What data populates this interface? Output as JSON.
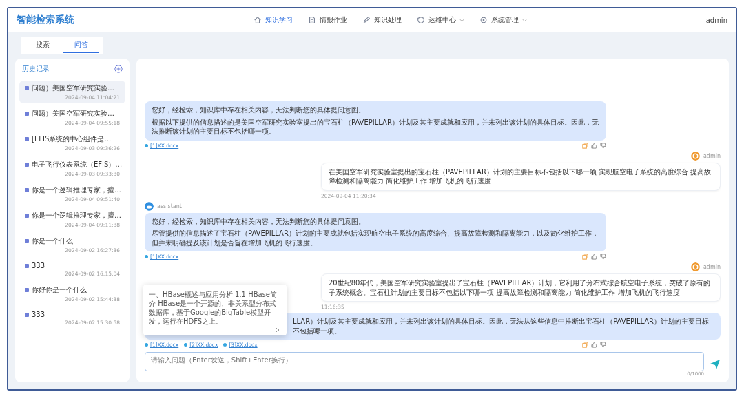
{
  "app": {
    "title": "智能检索系统",
    "user": "admin"
  },
  "nav": [
    {
      "label": "知识学习",
      "selected": true,
      "dropdown": false
    },
    {
      "label": "情报作业",
      "selected": false,
      "dropdown": false
    },
    {
      "label": "知识处理",
      "selected": false,
      "dropdown": false
    },
    {
      "label": "运维中心",
      "selected": false,
      "dropdown": true
    },
    {
      "label": "系统管理",
      "selected": false,
      "dropdown": true
    }
  ],
  "mode_tabs": [
    {
      "label": "搜索",
      "selected": false
    },
    {
      "label": "问答",
      "selected": true
    }
  ],
  "history": {
    "title": "历史记录",
    "items": [
      {
        "title": "问题）美国空军研究实验…",
        "time": "2024-09-04 11:04:21",
        "selected": true
      },
      {
        "title": "问题）美国空军研究实验…",
        "time": "2024-09-04 09:55:18",
        "selected": false
      },
      {
        "title": "[EFIS系统的中心组件是…",
        "time": "2024-09-03 09:36:26",
        "selected": false
      },
      {
        "title": "电子飞行仪表系统（EFIS）…",
        "time": "2024-09-03 09:33:30",
        "selected": false
      },
      {
        "title": "你是一个逻辑推理专家，擅…",
        "time": "2024-09-04 09:51:40",
        "selected": false
      },
      {
        "title": "你是一个逻辑推理专家，擅…",
        "time": "2024-09-04 09:11:38",
        "selected": false
      },
      {
        "title": "你是一个什么",
        "time": "2024-09-02 16:27:36",
        "selected": false
      },
      {
        "title": "333",
        "time": "2024-09-02 16:15:04",
        "selected": false
      },
      {
        "title": "你好你是一个什么",
        "time": "2024-09-02 15:44:38",
        "selected": false
      },
      {
        "title": "333",
        "time": "2024-09-02 15:30:58",
        "selected": false
      }
    ]
  },
  "messages": [
    {
      "kind": "answer",
      "paragraphs": [
        "您好，经检索，知识库中存在相关内容，无法判断您的具体提问意图。",
        "根据以下提供的信息描述的是美国空军研究实验室提出的宝石柱（PAVEPILLAR）计划及其主要成就和应用，并未列出该计划的具体目标。因此，无法推断该计划的主要目标不包括哪一项。"
      ],
      "sources": [
        "[1]XX.docx"
      ]
    },
    {
      "kind": "question",
      "name": "admin",
      "text": "在美国空军研究实验室提出的宝石柱（PAVEPILLAR）计划的主要目标不包括以下哪一项 实现航空电子系统的高度综合 提高故障检测和隔离能力 简化维护工作 增加飞机的飞行速度",
      "time": "2024-09-04 11:20:34"
    },
    {
      "kind": "answer",
      "name": "assistant",
      "paragraphs": [
        "您好，经检索，知识库中存在相关内容，无法判断您的具体提问意图。",
        "尽管提供的信息描述了宝石柱（PAVEPILLAR）计划的主要成就包括实现航空电子系统的高度综合、提高故障检测和隔离能力，以及简化维护工作，但并未明确提及该计划是否旨在增加飞机的飞行速度。"
      ],
      "sources": [
        "[1]XX.docx"
      ]
    },
    {
      "kind": "question",
      "name": "admin",
      "text": "20世纪80年代，美国空军研究实验室提出了宝石柱（PAVEPILLAR）计划，它利用了分布式综合航空电子系统，突破了原有的子系统概念。宝石柱计划的主要目标不包括以下哪一项 提高故障检测和隔离能力 简化维护工作 增加飞机的飞行速度",
      "time": "11:16:35"
    },
    {
      "kind": "answer",
      "partial": true,
      "paragraphs": [
        "LLAR）计划及其主要成就和应用，并未列出该计划的具体目标。因此，无法从这些信息中推断出宝石柱（PAVEPILLAR）计划的主要目标不包括哪一项。"
      ],
      "sources": [
        "[1]XX.docx",
        "[2]XX.docx",
        "[3]XX.docx"
      ]
    }
  ],
  "popup": {
    "text": "一、HBase概述与应用分析 1.1 HBase简介 HBase是一个开源的、非关系型分布式数据库，基于Google的BigTable模型开发，运行在HDFS之上。"
  },
  "input": {
    "placeholder": "请输入问题（Enter发送，Shift+Enter换行）",
    "counter": "0/1000"
  }
}
